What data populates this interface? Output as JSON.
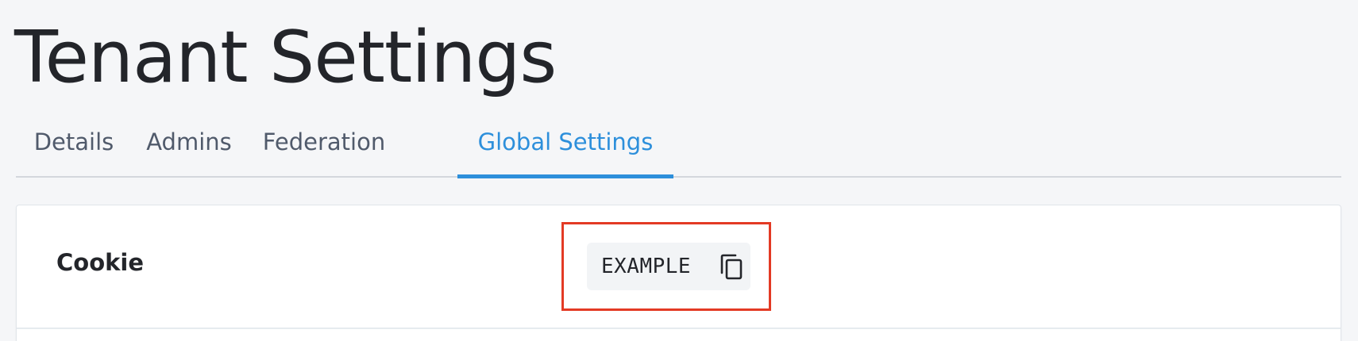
{
  "page": {
    "title": "Tenant Settings"
  },
  "tabs": [
    {
      "label": "Details",
      "active": false
    },
    {
      "label": "Admins",
      "active": false
    },
    {
      "label": "Federation",
      "active": false
    },
    {
      "label": "Global Settings",
      "active": true
    }
  ],
  "settings": {
    "rows": [
      {
        "label": "Cookie",
        "value": "EXAMPLE",
        "action_icon": "copy-icon"
      }
    ]
  },
  "colors": {
    "accent": "#2d8fdb",
    "highlight": "#e33a24",
    "text": "#23252a",
    "tab_inactive": "#505a6b",
    "background": "#f5f6f8"
  }
}
